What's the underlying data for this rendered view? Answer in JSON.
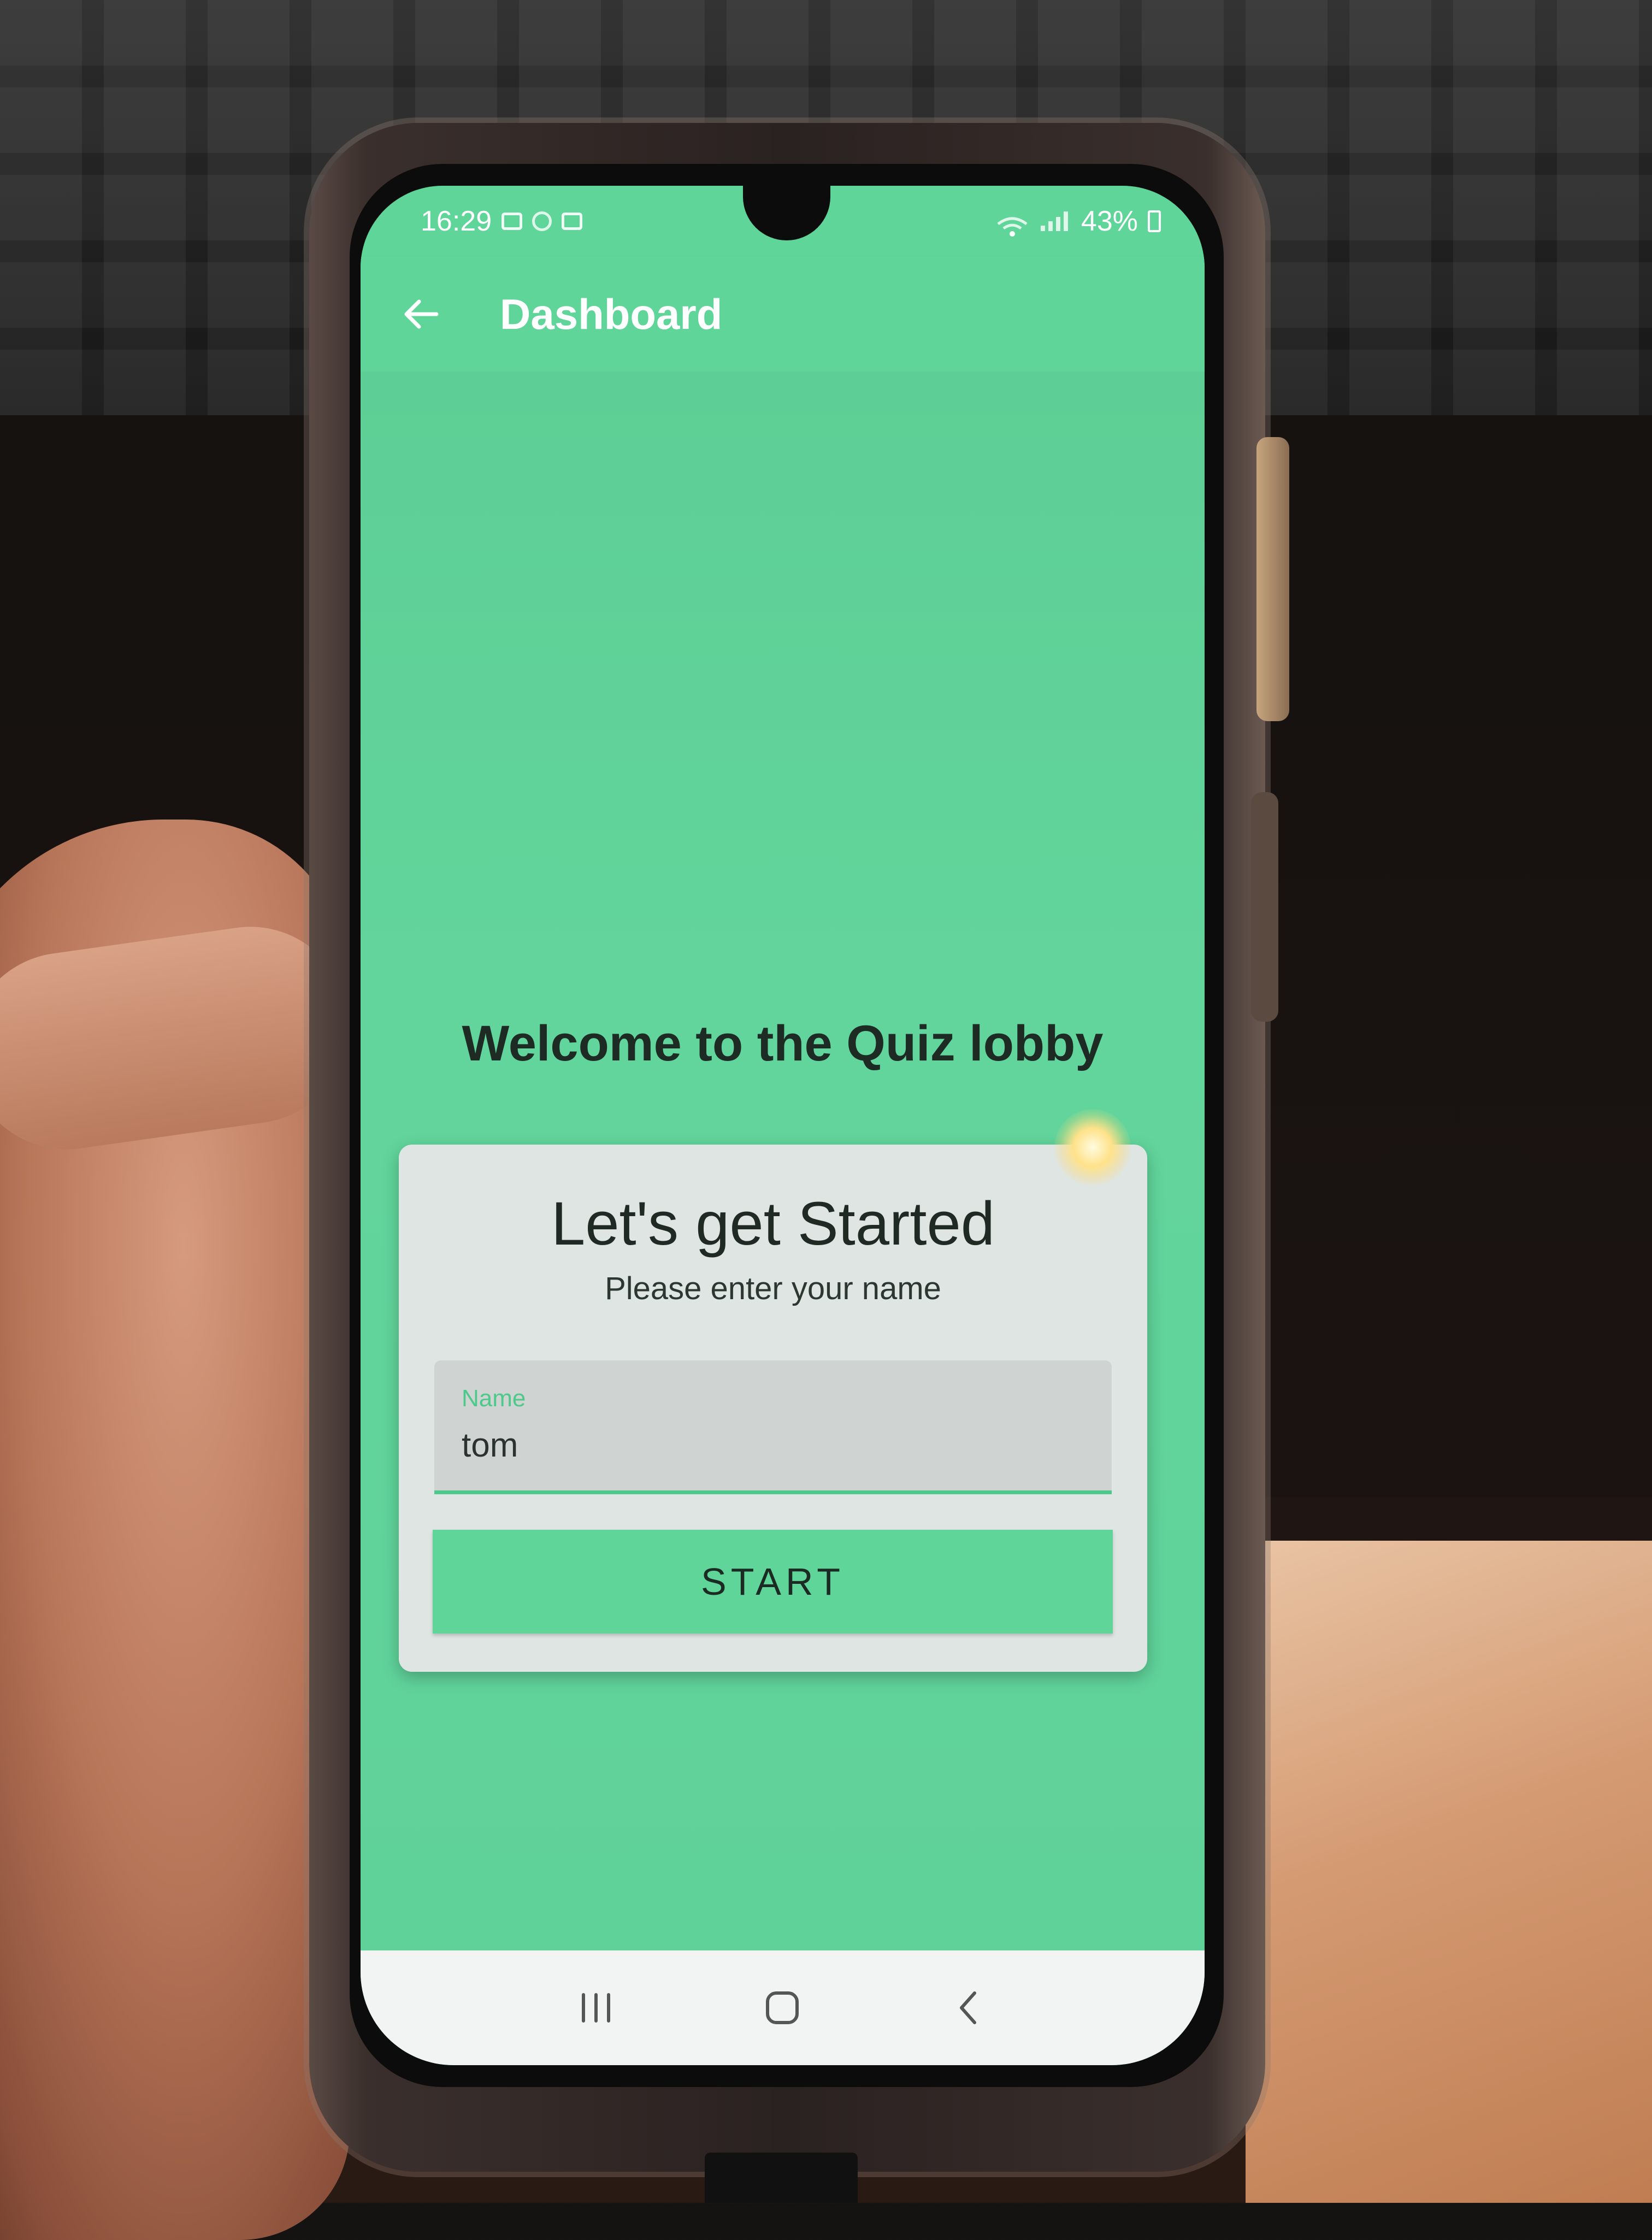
{
  "status_bar": {
    "time": "16:29",
    "battery": "43%"
  },
  "app_bar": {
    "title": "Dashboard",
    "back_icon": "arrow-left-icon"
  },
  "lobby": {
    "welcome": "Welcome to the Quiz lobby"
  },
  "card": {
    "title": "Let's get Started",
    "subtitle": "Please enter your name",
    "name_field": {
      "label": "Name",
      "value": "tom"
    },
    "start_button": "START"
  },
  "nav_bar": {
    "icons": [
      "recent-apps-icon",
      "home-icon",
      "back-icon"
    ]
  },
  "colors": {
    "primary": "#5fd59a",
    "accent": "#4fc98b",
    "card": "#dfe5e2"
  }
}
